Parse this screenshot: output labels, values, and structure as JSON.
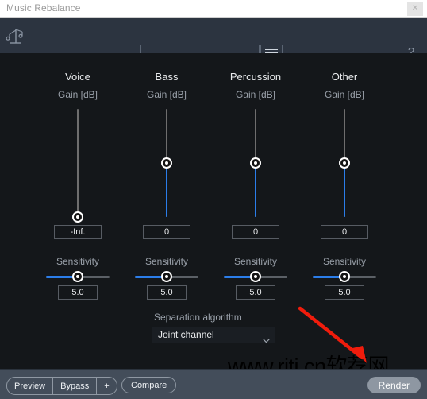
{
  "window": {
    "title": "Music Rebalance",
    "close_label": "✕"
  },
  "toolbar": {
    "logo_icon": "music-balance-icon",
    "preset_value": "",
    "preset_caret_icon": "chevron-down-icon",
    "menu_icon": "hamburger-menu-icon",
    "help_label": "?"
  },
  "columns": [
    {
      "name": "Voice",
      "gain_label": "Gain [dB]",
      "gain_value": "-Inf.",
      "gain_percent": 0,
      "sensitivity_label": "Sensitivity",
      "sensitivity_value": "5.0",
      "sensitivity_percent": 50
    },
    {
      "name": "Bass",
      "gain_label": "Gain [dB]",
      "gain_value": "0",
      "gain_percent": 50,
      "sensitivity_label": "Sensitivity",
      "sensitivity_value": "5.0",
      "sensitivity_percent": 50
    },
    {
      "name": "Percussion",
      "gain_label": "Gain [dB]",
      "gain_value": "0",
      "gain_percent": 50,
      "sensitivity_label": "Sensitivity",
      "sensitivity_value": "5.0",
      "sensitivity_percent": 50
    },
    {
      "name": "Other",
      "gain_label": "Gain [dB]",
      "gain_value": "0",
      "gain_percent": 50,
      "sensitivity_label": "Sensitivity",
      "sensitivity_value": "5.0",
      "sensitivity_percent": 50
    }
  ],
  "separation": {
    "label": "Separation algorithm",
    "value": "Joint channel",
    "caret_icon": "chevron-down-icon",
    "options": [
      "Joint channel"
    ]
  },
  "footer": {
    "preview_label": "Preview",
    "bypass_label": "Bypass",
    "plus_label": "+",
    "compare_label": "Compare",
    "render_label": "Render"
  },
  "annotations": {
    "watermark": "www.rjtj.cn软荐网",
    "arrow_color": "#f01c0c"
  },
  "colors": {
    "accent_blue": "#2b7de9",
    "panel_bg": "#14171a",
    "toolbar_bg": "#2c3440",
    "footer_bg": "#434d5a"
  }
}
